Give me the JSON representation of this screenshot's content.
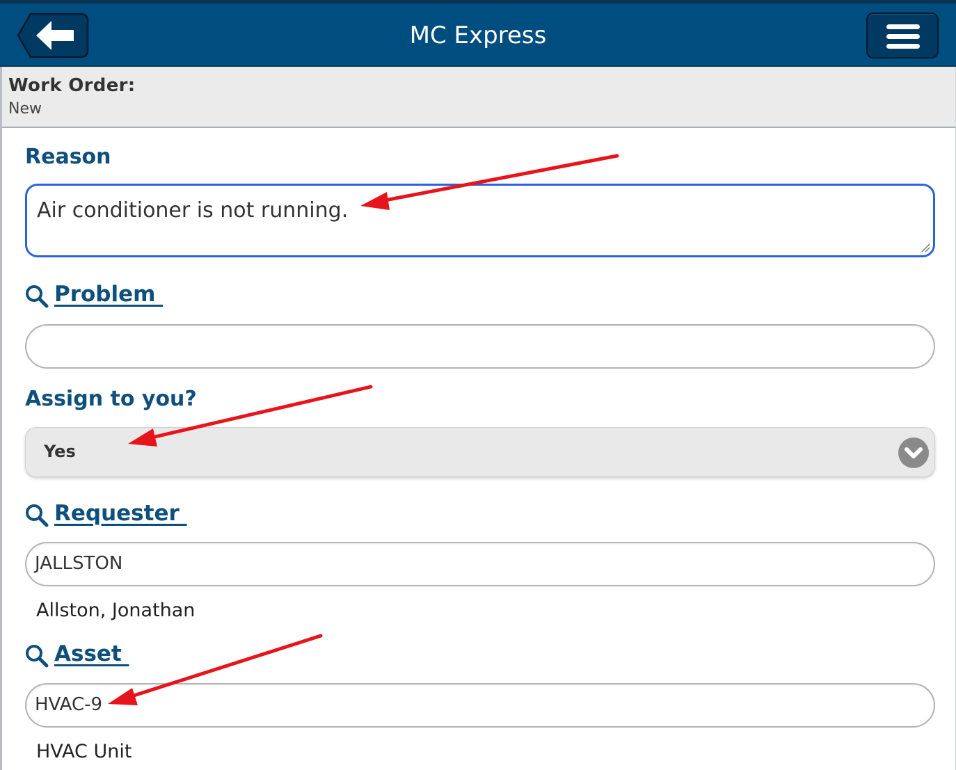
{
  "header": {
    "title": "MC Express",
    "back_icon": "arrow-left-icon",
    "menu_icon": "hamburger-menu-icon",
    "bg_color": "#004d80"
  },
  "subheader": {
    "label": "Work Order:",
    "value": "New"
  },
  "form": {
    "reason": {
      "label": "Reason",
      "value": "Air conditioner is not running."
    },
    "problem": {
      "label": "Problem ",
      "value": ""
    },
    "assign": {
      "label": "Assign to you?",
      "selected": "Yes"
    },
    "requester": {
      "label": "Requester ",
      "value": "JALLSTON",
      "description": "Allston, Jonathan"
    },
    "asset": {
      "label": "Asset ",
      "value": "HVAC-9",
      "description": "HVAC Unit"
    }
  },
  "annotations": {
    "arrow_color": "#e8141b"
  }
}
